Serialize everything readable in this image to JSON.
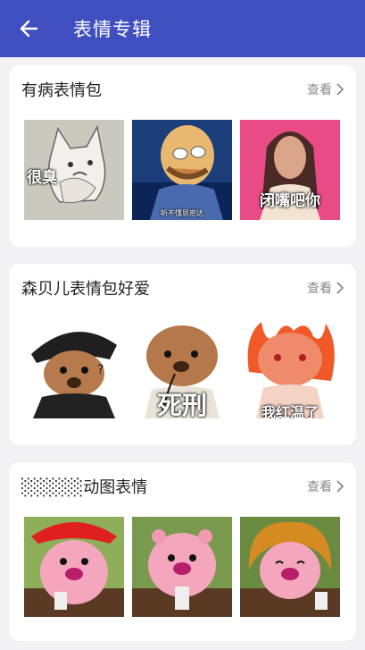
{
  "appbar": {
    "title": "表情专辑"
  },
  "albums": [
    {
      "title": "有病表情包",
      "more_label": "查看",
      "stickers": [
        {
          "name": "cat-sticker",
          "caption": "很臭"
        },
        {
          "name": "bald-man-sticker",
          "caption": "听不懂思密达"
        },
        {
          "name": "girl-sticker",
          "caption": "闭嘴吧你"
        }
      ]
    },
    {
      "title": "森贝儿表情包好爱",
      "more_label": "查看",
      "stickers": [
        {
          "name": "police-bear-sticker",
          "caption": ""
        },
        {
          "name": "microphone-bear-sticker",
          "caption": "死刑"
        },
        {
          "name": "angry-bear-sticker",
          "caption": "我红温了"
        }
      ]
    },
    {
      "title": "░░░░░动图表情",
      "more_label": "查看",
      "stickers": [
        {
          "name": "loopy-red-hat-sticker",
          "caption": ""
        },
        {
          "name": "loopy-phone-sticker",
          "caption": ""
        },
        {
          "name": "loopy-wig-sticker",
          "caption": ""
        }
      ]
    }
  ],
  "colors": {
    "appbar": "#3f4fc0",
    "background": "#f2f2f4",
    "card": "#ffffff"
  }
}
